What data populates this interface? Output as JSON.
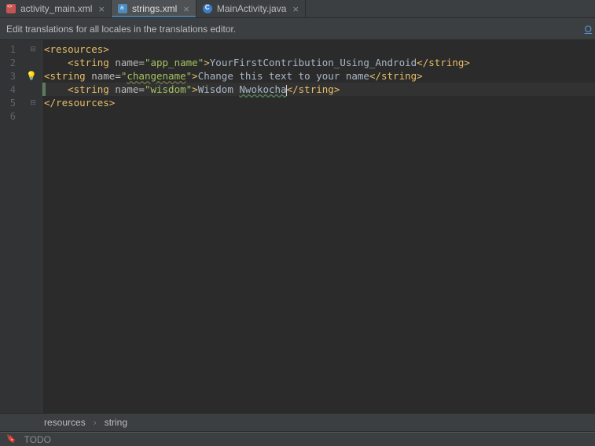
{
  "tabs": [
    {
      "label": "activity_main.xml"
    },
    {
      "label": "strings.xml"
    },
    {
      "label": "MainActivity.java"
    }
  ],
  "hint": {
    "text": "Edit translations for all locales in the translations editor.",
    "right": "O"
  },
  "lines": [
    {
      "no": "1",
      "fold": "⊟"
    },
    {
      "no": "2",
      "fold": ""
    },
    {
      "no": "3",
      "fold": "",
      "bulb": true
    },
    {
      "no": "4",
      "fold": ""
    },
    {
      "no": "5",
      "fold": "⊟"
    },
    {
      "no": "6",
      "fold": ""
    }
  ],
  "code": {
    "l1": {
      "open": "<resources",
      "close": ">"
    },
    "l2": {
      "indent": "    ",
      "string_open": "<string",
      "name_attr": " name=",
      "q1": "\"",
      "name_val": "app_name",
      "q2": "\"",
      "gt": ">",
      "text": "YourFirstContribution_Using_Android",
      "close": "</string",
      "gt2": ">"
    },
    "l3": {
      "indent": "",
      "string_open": "<string",
      "name_attr": " name=",
      "q1": "\"",
      "name_val": "changename",
      "q2": "\"",
      "gt": ">",
      "text": "Change this text to your name",
      "close": "</string",
      "gt2": ">"
    },
    "l4": {
      "indent": "    ",
      "string_open": "<string",
      "name_attr": " name=",
      "q1": "\"",
      "name_val": "wisdom",
      "q2": "\"",
      "gt": ">",
      "text_a": "Wisdom ",
      "text_b": "Nwokocha",
      "close": "</string",
      "gt2": ">"
    },
    "l5": {
      "close": "</resources",
      "gt": ">"
    }
  },
  "breadcrumb": {
    "a": "resources",
    "b": "string"
  },
  "status": {
    "todo": "TODO"
  }
}
